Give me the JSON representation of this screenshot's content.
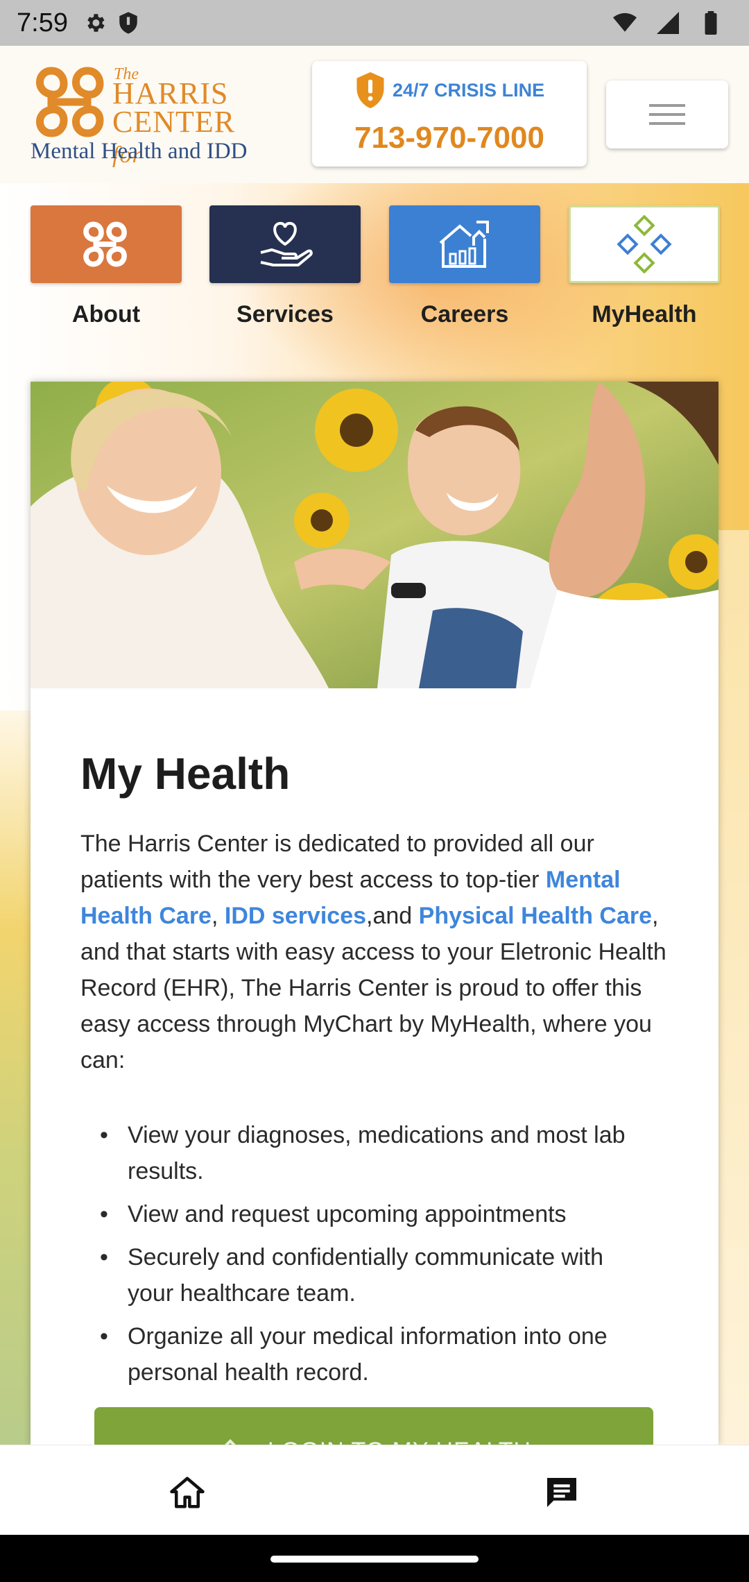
{
  "status_bar": {
    "time": "7:59"
  },
  "header": {
    "logo": {
      "the": "The",
      "line1": "HARRIS",
      "line2": "CENTER",
      "for": "for",
      "subtitle": "Mental Health and IDD"
    },
    "crisis": {
      "label": "24/7 CRISIS LINE",
      "phone": "713-970-7000",
      "icon": "shield-alert-icon"
    },
    "menu_icon": "hamburger-menu-icon"
  },
  "nav_tiles": [
    {
      "label": "About",
      "icon": "harris-logo-icon",
      "color": "#d9773f"
    },
    {
      "label": "Services",
      "icon": "heart-hand-icon",
      "color": "#263151"
    },
    {
      "label": "Careers",
      "icon": "building-growth-icon",
      "color": "#3c80d3"
    },
    {
      "label": "MyHealth",
      "icon": "diamonds-icon",
      "color": "#ffffff"
    }
  ],
  "card": {
    "title": "My Health",
    "intro": {
      "p1": "The Harris Center is dedicated to provided all our patients with the very best access to top-tier ",
      "link1": "Mental Health Care",
      "p2": ", ",
      "link2": "IDD services",
      "p3": ",and ",
      "link3": "Physical Health Care",
      "p4": ", and that starts with easy access to your Eletronic Health Record (EHR), The Harris Center is proud to offer this easy access through MyChart by MyHealth, where you can:"
    },
    "bullets": [
      "View your diagnoses, medications and most lab results.",
      "View and request upcoming appointments",
      "Securely and confidentially communicate with your healthcare team.",
      "Organize all your medical information into one personal health record."
    ],
    "login_label": "LOGIN TO MY HEALTH"
  },
  "bottom_nav": {
    "items": [
      "home-icon",
      "chat-icon"
    ]
  },
  "colors": {
    "brand_orange": "#e08a2a",
    "link_blue": "#3e86dc",
    "login_green": "#7ea43a"
  }
}
